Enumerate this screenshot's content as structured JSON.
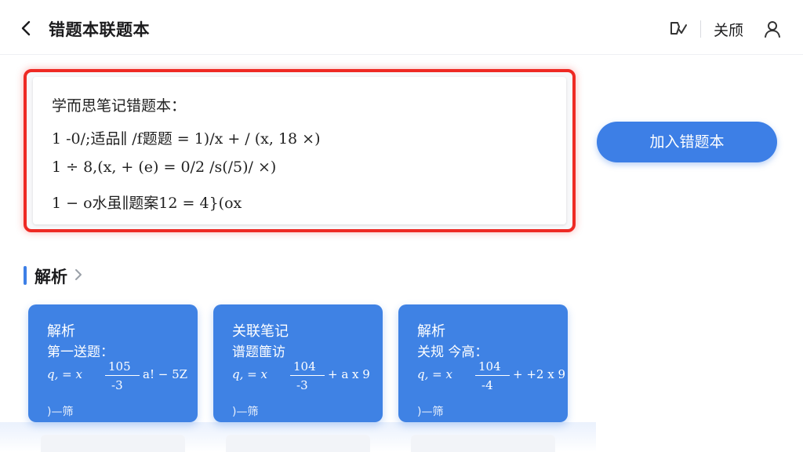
{
  "header": {
    "title": "错题本联题本",
    "text_button": "关颀"
  },
  "question": {
    "heading": "学而思笔记错题本：",
    "lines": [
      "1 -0/;适品∥ /f题题 = 1)/x + / (x, 18 ×)",
      "1 ÷ 8,(x, + (e) = 0/2 /s(/5)/ ×)",
      "1 − o水虽∥题案12 = 4}(ox"
    ]
  },
  "add_button": "加入错题本",
  "section": {
    "title": "解析"
  },
  "cards": [
    {
      "title": "解析",
      "subtitle": "第一送题：",
      "lhs": "q, = x",
      "numerator": "105",
      "denominator": "-3",
      "rhs": "a! − 5Z",
      "footer": ")—筛"
    },
    {
      "title": "关联笔记",
      "subtitle": "谱题篚访",
      "lhs": "q, = x",
      "numerator": "104",
      "denominator": "-3",
      "rhs": "+ a x 9",
      "footer": ")—筛"
    },
    {
      "title": "解析",
      "subtitle": "关规 今高：",
      "lhs": "q, = x",
      "numerator": "104",
      "denominator": "-4",
      "rhs": "+ +2 x 9",
      "footer": ")—筛"
    }
  ],
  "colors": {
    "accent": "#3d7fe6",
    "highlight_border": "#ee2a24",
    "card_blue": "#3f82e4"
  }
}
